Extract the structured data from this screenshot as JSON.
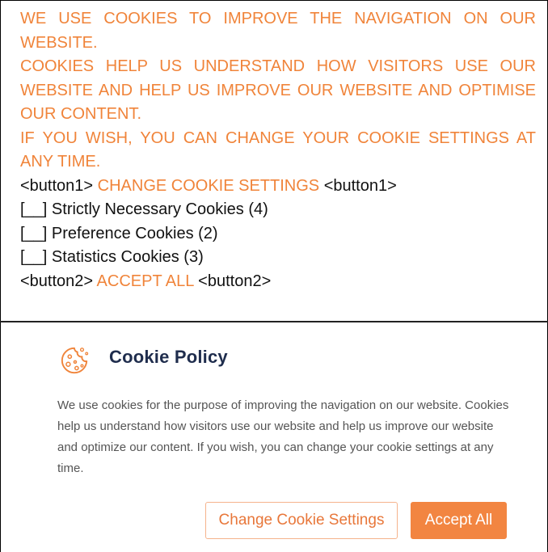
{
  "top_text": {
    "p1": "WE USE COOKIES TO IMPROVE THE NAVIGATION ON OUR WEBSITE.",
    "p2": "COOKIES HELP US UNDERSTAND HOW VISITORS USE OUR WEBSITE AND HELP US IMPROVE OUR WEBSITE AND OPTIMISE OUR CONTENT.",
    "p3": "IF YOU WISH, YOU CAN CHANGE YOUR COOKIE SETTINGS AT ANY TIME.",
    "button1_tag": "<button1>",
    "button1_label": "CHANGE COOKIE SETTINGS",
    "checkbox_mark": "[__]",
    "checkboxes": [
      "Strictly Necessary Cookies (4)",
      "Preference Cookies (2)",
      "Statistics Cookies (3)"
    ],
    "button2_tag": "<button2>",
    "button2_label": "ACCEPT ALL"
  },
  "dialog": {
    "icon": "cookie-icon",
    "title": "Cookie Policy",
    "description": "We use cookies for the purpose of improving the navigation on our website. Cookies help us understand how visitors use our website and help us improve our website and optimize our content. If you wish, you can change your cookie settings at any time.",
    "change_label": "Change Cookie Settings",
    "accept_label": "Accept All"
  },
  "colors": {
    "accent": "#f0843a",
    "title": "#1f2d4d",
    "body_text": "#555555"
  }
}
